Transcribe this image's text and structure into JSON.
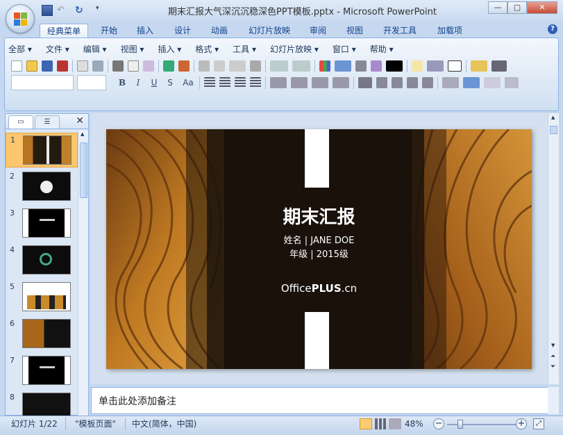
{
  "window": {
    "title": "期末汇报大气深沉沉稳深色PPT模板.pptx - Microsoft PowerPoint",
    "min_icon": "minimize-icon",
    "max_icon": "maximize-icon",
    "close_icon": "close-icon"
  },
  "ribbon_tabs": [
    "经典菜单",
    "开始",
    "插入",
    "设计",
    "动画",
    "幻灯片放映",
    "审阅",
    "视图",
    "开发工具",
    "加载项"
  ],
  "active_tab": "经典菜单",
  "menus": [
    "全部",
    "文件",
    "编辑",
    "视图",
    "插入",
    "格式",
    "工具",
    "幻灯片放映",
    "窗口",
    "帮助"
  ],
  "format_buttons": [
    "B",
    "I",
    "U",
    "S",
    "Aa"
  ],
  "slide": {
    "title": "期末汇报",
    "name_line": "姓名 | JANE DOE",
    "grade_line": "年级 | 2015级",
    "brand_prefix": "Office",
    "brand_bold": "PLUS",
    "brand_suffix": ".cn"
  },
  "thumbnails": [
    {
      "num": "1",
      "caption": "期末汇报"
    },
    {
      "num": "2",
      "caption": "CONTENTS"
    },
    {
      "num": "3",
      "caption": "PART ONE"
    },
    {
      "num": "4",
      "caption": ""
    },
    {
      "num": "5",
      "caption": ""
    },
    {
      "num": "6",
      "caption": ""
    },
    {
      "num": "7",
      "caption": "PART TWO"
    },
    {
      "num": "8",
      "caption": ""
    }
  ],
  "notes_placeholder": "单击此处添加备注",
  "status": {
    "slide_info": "幻灯片 1/22",
    "theme": "\"模板页面\"",
    "language": "中文(简体，中国)",
    "zoom": "48%"
  },
  "colors": {
    "accent": "#15428b",
    "selected_thumb": "#fdc66f"
  }
}
